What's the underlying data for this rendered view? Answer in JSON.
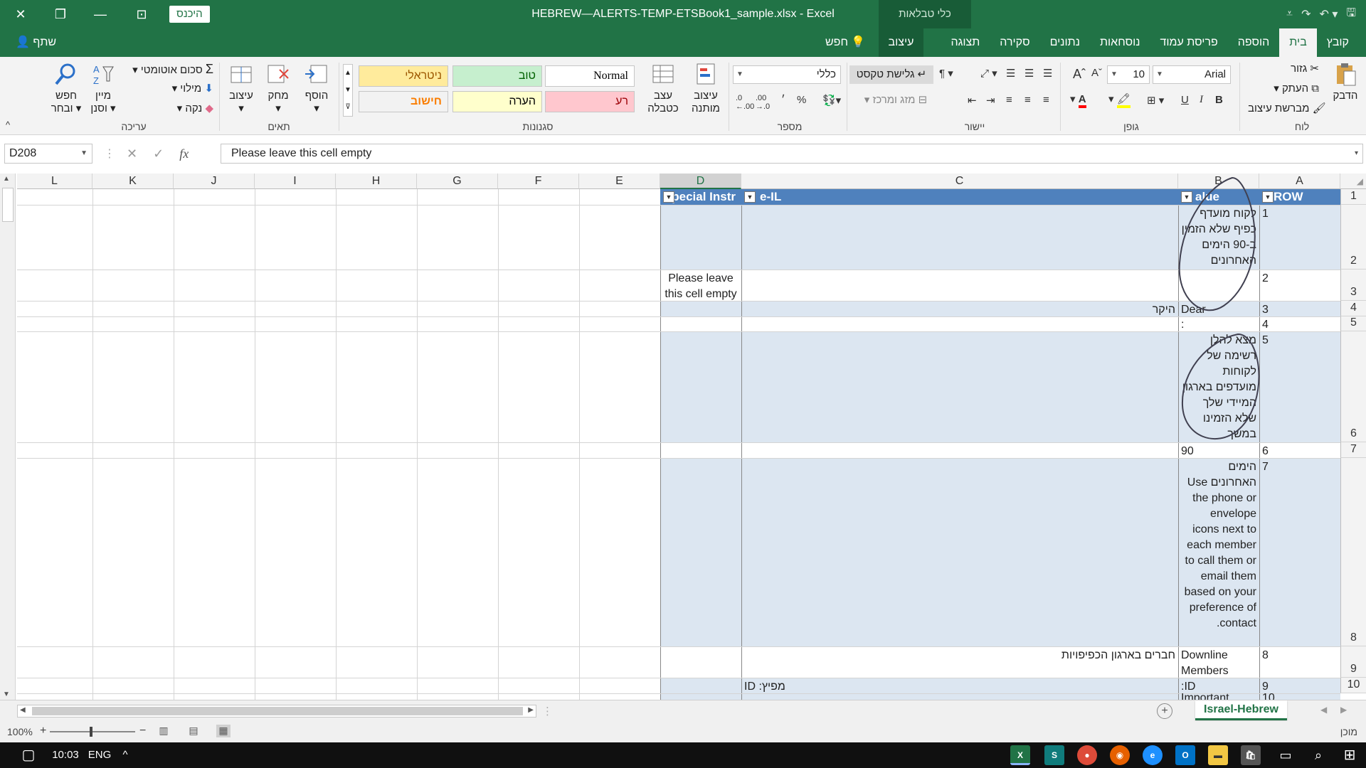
{
  "titlebar": {
    "title": "HEBREW—ALERTS-TEMP-ETSBook1_sample.xlsx  -  Excel",
    "sign_in": "היכנס",
    "contextual_group": "כלי טבלאות"
  },
  "tabs": [
    {
      "label": "קובץ"
    },
    {
      "label": "בית",
      "active": true
    },
    {
      "label": "הוספה"
    },
    {
      "label": "פריסת עמוד"
    },
    {
      "label": "נוסחאות"
    },
    {
      "label": "נתונים"
    },
    {
      "label": "סקירה"
    },
    {
      "label": "תצוגה"
    },
    {
      "label": "עיצוב",
      "contextual": true
    }
  ],
  "tell_me": "חפש",
  "share": "שתף",
  "ribbon": {
    "clipboard": {
      "label": "לוח",
      "paste": "הדבק",
      "cut": "גזור",
      "copy": "העתק",
      "format_painter": "מברשת עיצוב"
    },
    "font": {
      "label": "גופן",
      "font_name": "Arial",
      "font_size": "10",
      "bold": "B",
      "italic": "I",
      "underline": "U",
      "grow": "A",
      "shrink": "A"
    },
    "alignment": {
      "label": "יישור",
      "wrap_text": "גלישת טקסט",
      "merge_center": "מזג ומרכז"
    },
    "number": {
      "label": "מספר",
      "format": "כללי",
      "percent": "%",
      "comma": "׳"
    },
    "styles": {
      "label": "סגנונות",
      "conditional_formatting": "עיצוב מותנה",
      "format_as_table": "עצב כטבלה",
      "cells": [
        {
          "name": "Normal",
          "bg": "#ffffff",
          "fg": "#000000"
        },
        {
          "name": "טוב",
          "bg": "#c6efce",
          "fg": "#006100"
        },
        {
          "name": "ניטראלי",
          "bg": "#ffeb9c",
          "fg": "#9c5700"
        },
        {
          "name": "רע",
          "bg": "#ffc7ce",
          "fg": "#9c0006"
        },
        {
          "name": "הערה",
          "bg": "#ffffcc",
          "fg": "#000000"
        },
        {
          "name": "חישוב",
          "bg": "#f2f2f2",
          "fg": "#fa7d00"
        }
      ]
    },
    "cells": {
      "label": "תאים",
      "insert": "הוסף",
      "delete": "מחק",
      "format": "עיצוב"
    },
    "editing": {
      "label": "עריכה",
      "autosum": "סכום אוטומטי",
      "fill": "מילוי",
      "clear": "נקה",
      "sort_filter_1": "מיין",
      "sort_filter_2": "וסנן",
      "find_select_1": "חפש",
      "find_select_2": "ובחר"
    }
  },
  "formula_bar": {
    "name_box": "D208",
    "cancel": "✕",
    "enter": "✓",
    "fx": "fx",
    "content": "Please leave this cell empty"
  },
  "grid": {
    "columns": [
      "L",
      "K",
      "J",
      "I",
      "H",
      "G",
      "F",
      "E",
      "D",
      "C",
      "B",
      "A"
    ],
    "selected_column": "D",
    "row_numbers": [
      "1",
      "2",
      "3",
      "4",
      "5",
      "6",
      "7",
      "8",
      "9",
      "10"
    ],
    "headers": {
      "D": "pecial Instr",
      "C": "e-IL",
      "B": "alue",
      "A": "ROW"
    },
    "cells": {
      "a2": "1",
      "b2": "לקוח מועדף כפיף שלא הזמין ב-90 הימים האחרונים",
      "a3": "2",
      "d3": "Please leave this cell empty",
      "a4": "3",
      "b4": "Dear",
      "c4": "היקר",
      "a5": "4",
      "b5": ":",
      "a6": "5",
      "b6": "מצא להלן רשימה של לקוחות מועדפים בארגון המיידי שלך שלא הזמינו במשך",
      "a7": "6",
      "b7": "90",
      "a8": "7",
      "b8": "הימים האחרונים Use the phone or envelope icons next to each member to call them or email them based on your preference of contact.",
      "a9": "8",
      "b9": "Downline Members",
      "c9": "חברים בארגון הכפיפויות",
      "a10": "9",
      "b10": ":ID",
      "c10": "ID :מפיץ",
      "a11": "10",
      "b11": "Important"
    }
  },
  "sheet_tab": "Israel-Hebrew",
  "status": {
    "zoom": "100%",
    "ready": "מוכן"
  },
  "taskbar": {
    "time": "10:03",
    "lang": "ENG"
  }
}
